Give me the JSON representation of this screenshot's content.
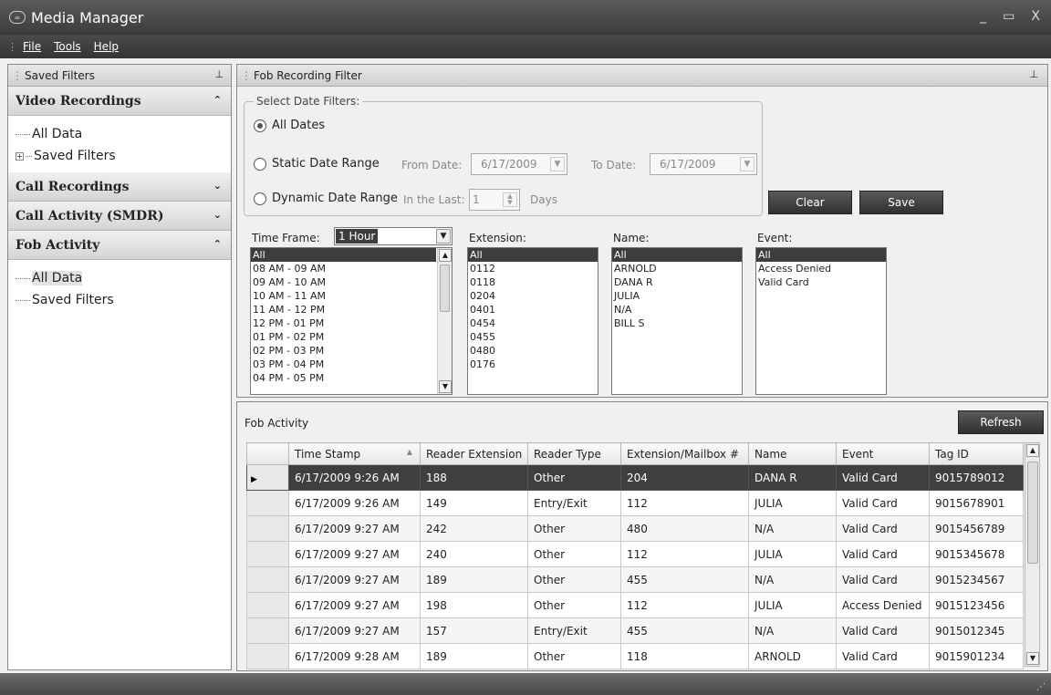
{
  "window": {
    "title": "Media Manager",
    "app_icon_text": "∞"
  },
  "menu": [
    "File",
    "Tools",
    "Help"
  ],
  "left_panel": {
    "header": "Saved Filters",
    "sections": [
      {
        "title": "Video Recordings",
        "expanded": true,
        "items": [
          "All Data",
          "Saved Filters"
        ]
      },
      {
        "title": "Call Recordings",
        "expanded": false
      },
      {
        "title": "Call Activity (SMDR)",
        "expanded": false
      },
      {
        "title": "Fob Activity",
        "expanded": true,
        "items": [
          "All Data",
          "Saved Filters"
        ]
      }
    ]
  },
  "filter": {
    "header": "Fob Recording Filter",
    "group_label": "Select Date Filters:",
    "options": {
      "all_dates": "All Dates",
      "static": "Static Date Range",
      "dynamic": "Dynamic Date Range"
    },
    "from_label": "From Date:",
    "from_value": "6/17/2009",
    "to_label": "To Date:",
    "to_value": "6/17/2009",
    "last_label": "In the Last:",
    "last_value": "1",
    "days_label": "Days",
    "clear": "Clear",
    "save": "Save",
    "timeframe_label": "Time Frame:",
    "timeframe_value": "1 Hour",
    "time_items": [
      "All",
      "08 AM - 09 AM",
      "09 AM - 10 AM",
      "10 AM - 11 AM",
      "11 AM - 12 PM",
      "12 PM - 01 PM",
      "01 PM - 02 PM",
      "02 PM - 03 PM",
      "03 PM - 04 PM",
      "04 PM - 05 PM"
    ],
    "extension_label": "Extension:",
    "extension_items": [
      "All",
      "0112",
      "0118",
      "0204",
      "0401",
      "0454",
      "0455",
      "0480",
      "0176"
    ],
    "name_label": "Name:",
    "name_items": [
      "All",
      "ARNOLD",
      "DANA R",
      "JULIA",
      "N/A",
      "BILL S"
    ],
    "event_label": "Event:",
    "event_items": [
      "All",
      "Access Denied",
      "Valid Card"
    ]
  },
  "activity": {
    "heading": "Fob Activity",
    "refresh": "Refresh",
    "columns": [
      "Time Stamp",
      "Reader Extension",
      "Reader Type",
      "Extension/Mailbox #",
      "Name",
      "Event",
      "Tag ID"
    ],
    "rows": [
      [
        "6/17/2009 9:26 AM",
        "188",
        "Other",
        "204",
        "DANA R",
        "Valid Card",
        "9015789012"
      ],
      [
        "6/17/2009 9:26 AM",
        "149",
        "Entry/Exit",
        "112",
        "JULIA",
        "Valid Card",
        "9015678901"
      ],
      [
        "6/17/2009 9:27 AM",
        "242",
        "Other",
        "480",
        "N/A",
        "Valid Card",
        "9015456789"
      ],
      [
        "6/17/2009 9:27 AM",
        "240",
        "Other",
        "112",
        "JULIA",
        "Valid Card",
        "9015345678"
      ],
      [
        "6/17/2009 9:27 AM",
        "189",
        "Other",
        "455",
        "N/A",
        "Valid Card",
        "9015234567"
      ],
      [
        "6/17/2009 9:27 AM",
        "198",
        "Other",
        "112",
        "JULIA",
        "Access Denied",
        "9015123456"
      ],
      [
        "6/17/2009 9:27 AM",
        "157",
        "Entry/Exit",
        "455",
        "N/A",
        "Valid Card",
        "9015012345"
      ],
      [
        "6/17/2009 9:28 AM",
        "189",
        "Other",
        "118",
        "ARNOLD",
        "Valid Card",
        "9015901234"
      ]
    ],
    "selected_row": 0
  }
}
